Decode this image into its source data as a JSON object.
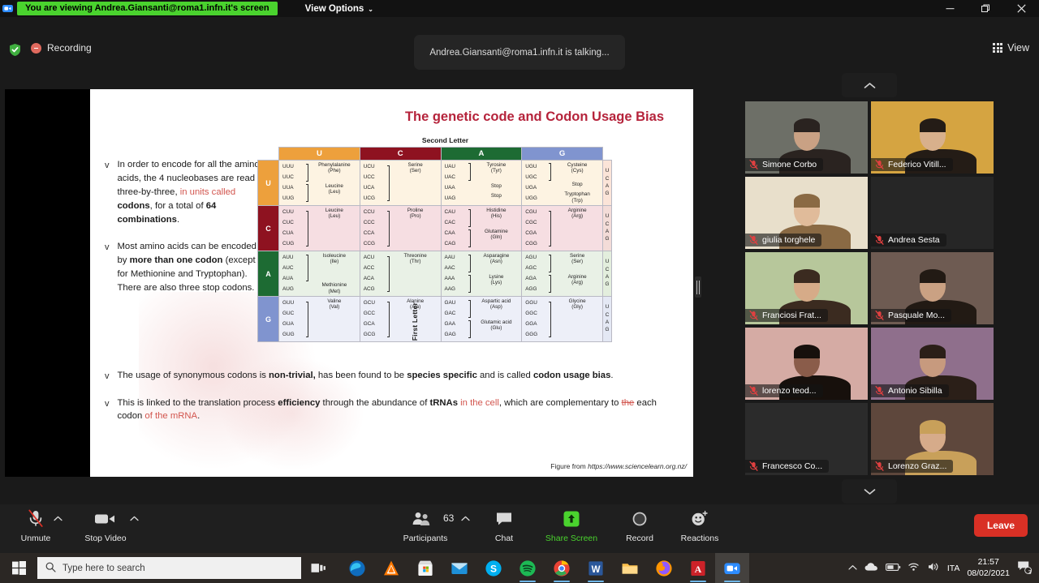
{
  "topbar": {
    "sharing_notice": "You are viewing Andrea.Giansanti@roma1.infn.it's screen",
    "view_options_label": "View Options",
    "caret": "⌄",
    "minimize_icon": "minimize-icon",
    "restore_icon": "restore-icon",
    "close_icon": "close-icon"
  },
  "status": {
    "shield_icon": "shield-icon",
    "recording_label": "Recording",
    "talking_text": "Andrea.Giansanti@roma1.infn.it  is talking...",
    "view_label": "View"
  },
  "slide": {
    "title": "The genetic code and Codon Usage Bias",
    "figure_credit_prefix": "Figure from ",
    "figure_credit_url": "https://www.sciencelearn.org.nz/",
    "bullet_mark": "v",
    "bullets_top": [
      {
        "parts": [
          {
            "t": "In order to encode for all the amino acids, the 4 nucleobases are read three-by-three,",
            "s": "plain"
          },
          {
            "t": " in units called ",
            "s": "hl"
          },
          {
            "t": "codons",
            "s": "bold"
          },
          {
            "t": ", for a total of ",
            "s": "plain"
          },
          {
            "t": "64 combinations",
            "s": "bold"
          },
          {
            "t": ".",
            "s": "plain"
          }
        ]
      },
      {
        "parts": [
          {
            "t": "Most amino acids can be encoded by ",
            "s": "plain"
          },
          {
            "t": "more than one codon",
            "s": "bold"
          },
          {
            "t": " (except for Methionine and Tryptophan). There are also three stop codons.",
            "s": "plain"
          }
        ]
      }
    ],
    "bullets_bottom": [
      {
        "parts": [
          {
            "t": "The usage of synonymous codons is ",
            "s": "plain"
          },
          {
            "t": "non-trivial,",
            "s": "bold"
          },
          {
            "t": " has been found to be ",
            "s": "plain"
          },
          {
            "t": "species specific",
            "s": "bold"
          },
          {
            "t": " and is called ",
            "s": "plain"
          },
          {
            "t": "codon usage bias",
            "s": "bold"
          },
          {
            "t": ".",
            "s": "plain"
          }
        ]
      },
      {
        "parts": [
          {
            "t": "This is linked to the translation process ",
            "s": "plain"
          },
          {
            "t": "efficiency",
            "s": "bold"
          },
          {
            "t": " through the abundance of ",
            "s": "plain"
          },
          {
            "t": "tRNAs",
            "s": "bold"
          },
          {
            "t": " in the cell",
            "s": "hl"
          },
          {
            "t": ", which are complementary to ",
            "s": "plain"
          },
          {
            "t": "the",
            "s": "strike"
          },
          {
            "t": " each codon ",
            "s": "plain"
          },
          {
            "t": "of the mRNA",
            "s": "hl"
          },
          {
            "t": ".",
            "s": "plain"
          }
        ]
      }
    ],
    "codon_table": {
      "second_letter_label": "Second Letter",
      "first_letter_label": "First Letter",
      "column_headers": [
        "U",
        "C",
        "A",
        "G"
      ],
      "row_labels": [
        "U",
        "C",
        "A",
        "G"
      ],
      "third_letters": [
        "U",
        "C",
        "A",
        "G"
      ],
      "header_colors": {
        "U": "#eda03c",
        "C": "#8e1220",
        "A": "#1d6b33",
        "G": "#8094cf"
      },
      "rows": [
        {
          "first": "U",
          "cells": [
            {
              "codons": [
                "UUU",
                "UUC",
                "UUA",
                "UUG"
              ],
              "groups": [
                {
                  "aa": "Phenylalanine",
                  "abbr": "(Phe)",
                  "n": 2
                },
                {
                  "aa": "Leucine",
                  "abbr": "(Leu)",
                  "n": 2
                }
              ]
            },
            {
              "codons": [
                "UCU",
                "UCC",
                "UCA",
                "UCG"
              ],
              "groups": [
                {
                  "aa": "Serine",
                  "abbr": "(Ser)",
                  "n": 4
                }
              ]
            },
            {
              "codons": [
                "UAU",
                "UAC",
                "UAA",
                "UAG"
              ],
              "groups": [
                {
                  "aa": "Tyrosine",
                  "abbr": "(Tyr)",
                  "n": 2
                },
                {
                  "aa": "Stop",
                  "abbr": "",
                  "n": 1
                },
                {
                  "aa": "Stop",
                  "abbr": "",
                  "n": 1
                }
              ]
            },
            {
              "codons": [
                "UGU",
                "UGC",
                "UGA",
                "UGG"
              ],
              "groups": [
                {
                  "aa": "Cysteine",
                  "abbr": "(Cys)",
                  "n": 2
                },
                {
                  "aa": "Stop",
                  "abbr": "",
                  "n": 1
                },
                {
                  "aa": "Tryptophan",
                  "abbr": "(Trp)",
                  "n": 1
                }
              ]
            }
          ]
        },
        {
          "first": "C",
          "cells": [
            {
              "codons": [
                "CUU",
                "CUC",
                "CUA",
                "CUG"
              ],
              "groups": [
                {
                  "aa": "Leucine",
                  "abbr": "(Leu)",
                  "n": 4
                }
              ]
            },
            {
              "codons": [
                "CCU",
                "CCC",
                "CCA",
                "CCG"
              ],
              "groups": [
                {
                  "aa": "Proline",
                  "abbr": "(Pro)",
                  "n": 4
                }
              ]
            },
            {
              "codons": [
                "CAU",
                "CAC",
                "CAA",
                "CAG"
              ],
              "groups": [
                {
                  "aa": "Histidine",
                  "abbr": "(His)",
                  "n": 2
                },
                {
                  "aa": "Glutamine",
                  "abbr": "(Gln)",
                  "n": 2
                }
              ]
            },
            {
              "codons": [
                "CGU",
                "CGC",
                "CGA",
                "CGG"
              ],
              "groups": [
                {
                  "aa": "Arginine",
                  "abbr": "(Arg)",
                  "n": 4
                }
              ]
            }
          ]
        },
        {
          "first": "A",
          "cells": [
            {
              "codons": [
                "AUU",
                "AUC",
                "AUA",
                "AUG"
              ],
              "groups": [
                {
                  "aa": "Isoleucine",
                  "abbr": "(Ile)",
                  "n": 3
                },
                {
                  "aa": "Methionine",
                  "abbr": "(Met)",
                  "n": 1
                }
              ]
            },
            {
              "codons": [
                "ACU",
                "ACC",
                "ACA",
                "ACG"
              ],
              "groups": [
                {
                  "aa": "Threonine",
                  "abbr": "(Thr)",
                  "n": 4
                }
              ]
            },
            {
              "codons": [
                "AAU",
                "AAC",
                "AAA",
                "AAG"
              ],
              "groups": [
                {
                  "aa": "Asparagine",
                  "abbr": "(Asn)",
                  "n": 2
                },
                {
                  "aa": "Lysine",
                  "abbr": "(Lys)",
                  "n": 2
                }
              ]
            },
            {
              "codons": [
                "AGU",
                "AGC",
                "AGA",
                "AGG"
              ],
              "groups": [
                {
                  "aa": "Serine",
                  "abbr": "(Ser)",
                  "n": 2
                },
                {
                  "aa": "Arginine",
                  "abbr": "(Arg)",
                  "n": 2
                }
              ]
            }
          ]
        },
        {
          "first": "G",
          "cells": [
            {
              "codons": [
                "GUU",
                "GUC",
                "GUA",
                "GUG"
              ],
              "groups": [
                {
                  "aa": "Valine",
                  "abbr": "(Val)",
                  "n": 4
                }
              ]
            },
            {
              "codons": [
                "GCU",
                "GCC",
                "GCA",
                "GCG"
              ],
              "groups": [
                {
                  "aa": "Alanine",
                  "abbr": "(Ala)",
                  "n": 4
                }
              ]
            },
            {
              "codons": [
                "GAU",
                "GAC",
                "GAA",
                "GAG"
              ],
              "groups": [
                {
                  "aa": "Aspartic acid",
                  "abbr": "(Asp)",
                  "n": 2
                },
                {
                  "aa": "Glutamic acid",
                  "abbr": "(Glu)",
                  "n": 2
                }
              ]
            },
            {
              "codons": [
                "GGU",
                "GGC",
                "GGA",
                "GGG"
              ],
              "groups": [
                {
                  "aa": "Glycine",
                  "abbr": "(Gly)",
                  "n": 4
                }
              ]
            }
          ]
        }
      ]
    }
  },
  "participants_strip": {
    "page_up_icon": "chevron-up-icon",
    "page_down_icon": "chevron-down-icon",
    "tiles": [
      {
        "name": "Simone Corbo",
        "muted": true,
        "video": true,
        "bg": "#6d6f67",
        "skin": "#c9a184",
        "hair": "#2a2320"
      },
      {
        "name": "Federico Vitill...",
        "muted": true,
        "video": true,
        "bg": "#d5a441",
        "skin": "#d8b08c",
        "hair": "#241c16"
      },
      {
        "name": "giulia torghele",
        "muted": true,
        "video": true,
        "bg": "#e8dfcb",
        "skin": "#e0bb9a",
        "hair": "#8a6a44"
      },
      {
        "name": "Andrea Sesta",
        "muted": true,
        "video": false,
        "bg": "#262626",
        "skin": "#000000",
        "hair": "#000000"
      },
      {
        "name": "Franciosi Frat...",
        "muted": true,
        "video": true,
        "bg": "#b7c79b",
        "skin": "#d6ab88",
        "hair": "#3b2b20"
      },
      {
        "name": "Pasquale Mo...",
        "muted": true,
        "video": true,
        "bg": "#6e5b52",
        "skin": "#caa183",
        "hair": "#221a14"
      },
      {
        "name": "lorenzo teod...",
        "muted": true,
        "video": true,
        "bg": "#d5aba4",
        "skin": "#8a5c4a",
        "hair": "#17100c"
      },
      {
        "name": "Antonio Sibilla",
        "muted": true,
        "video": true,
        "bg": "#8f6f8c",
        "skin": "#c79a7e",
        "hair": "#2b1f18"
      },
      {
        "name": "Francesco Co...",
        "muted": true,
        "video": false,
        "bg": "#2b2b2b",
        "skin": "#000000",
        "hair": "#000000"
      },
      {
        "name": "Lorenzo Graz...",
        "muted": true,
        "video": true,
        "bg": "#5e473c",
        "skin": "#d6ab8a",
        "hair": "#c8a05a"
      }
    ]
  },
  "toolbar": {
    "mute": {
      "label": "Unmute",
      "icon": "microphone-muted-icon"
    },
    "video": {
      "label": "Stop Video",
      "icon": "camera-icon"
    },
    "participants": {
      "label": "Participants",
      "count": "63",
      "icon": "participants-icon"
    },
    "chat": {
      "label": "Chat",
      "icon": "chat-bubble-icon"
    },
    "share": {
      "label": "Share Screen",
      "icon": "share-screen-icon",
      "color": "#4ad32e"
    },
    "record": {
      "label": "Record",
      "icon": "record-circle-icon"
    },
    "reactions": {
      "label": "Reactions",
      "icon": "smiley-plus-icon"
    },
    "leave": {
      "label": "Leave",
      "color": "#d93025"
    },
    "audio_caret": "⌃",
    "video_caret": "⌃",
    "participants_caret": "⌃"
  },
  "taskbar": {
    "start_icon": "windows-start-icon",
    "search_placeholder": "Type here to search",
    "search_icon": "search-icon",
    "task_view_icon": "task-view-icon",
    "apps": [
      {
        "name": "microsoft-edge-icon",
        "active": false
      },
      {
        "name": "avast-icon",
        "active": false
      },
      {
        "name": "microsoft-store-icon",
        "active": false
      },
      {
        "name": "mail-icon",
        "active": false
      },
      {
        "name": "skype-icon",
        "active": false
      },
      {
        "name": "spotify-icon",
        "active": true
      },
      {
        "name": "google-chrome-icon",
        "active": true
      },
      {
        "name": "microsoft-word-icon",
        "active": true
      },
      {
        "name": "file-explorer-icon",
        "active": false
      },
      {
        "name": "firefox-icon",
        "active": false
      },
      {
        "name": "adobe-acrobat-icon",
        "active": true
      },
      {
        "name": "zoom-icon",
        "active": true
      }
    ],
    "tray": {
      "overflow_icon": "chevron-up-icon",
      "onedrive_icon": "onedrive-cloud-icon",
      "battery_icon": "battery-icon",
      "wifi_icon": "wifi-icon",
      "volume_icon": "speaker-icon",
      "language": "ITA",
      "time": "21:57",
      "date": "08/02/2021",
      "notifications_icon": "notifications-icon",
      "notifications_count": "3"
    }
  }
}
